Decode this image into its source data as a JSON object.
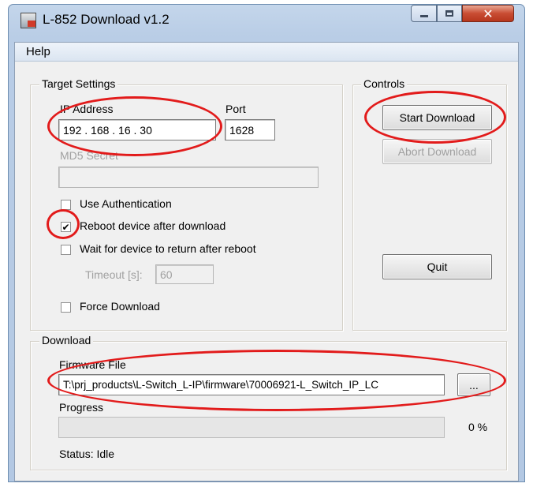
{
  "window": {
    "title": "L-852 Download v1.2"
  },
  "menu": {
    "help": "Help"
  },
  "target_settings": {
    "title": "Target Settings",
    "ip_label": "IP Address",
    "ip_value": "192 . 168 .  16  .  30",
    "port_label": "Port",
    "port_value": "1628",
    "md5_label": "MD5 Secret",
    "md5_value": "",
    "use_auth_label": "Use Authentication",
    "use_auth_checked": false,
    "reboot_label": "Reboot device after download",
    "reboot_checked": true,
    "reboot_mark": "✔",
    "wait_label": "Wait for device to return after reboot",
    "wait_checked": false,
    "timeout_label": "Timeout [s]:",
    "timeout_value": "60",
    "force_label": "Force Download",
    "force_checked": false
  },
  "controls": {
    "title": "Controls",
    "start_label": "Start Download",
    "abort_label": "Abort Download",
    "quit_label": "Quit"
  },
  "download": {
    "title": "Download",
    "firmware_label": "Firmware File",
    "firmware_path": "T:\\prj_products\\L-Switch_L-IP\\firmware\\70006921-L_Switch_IP_LC",
    "browse_label": "...",
    "progress_label": "Progress",
    "progress_value": 0,
    "progress_text": "0 %",
    "status_text": "Status: Idle"
  },
  "colors": {
    "annotation": "#e21b1b",
    "titlebar": "#c4d6eb"
  }
}
